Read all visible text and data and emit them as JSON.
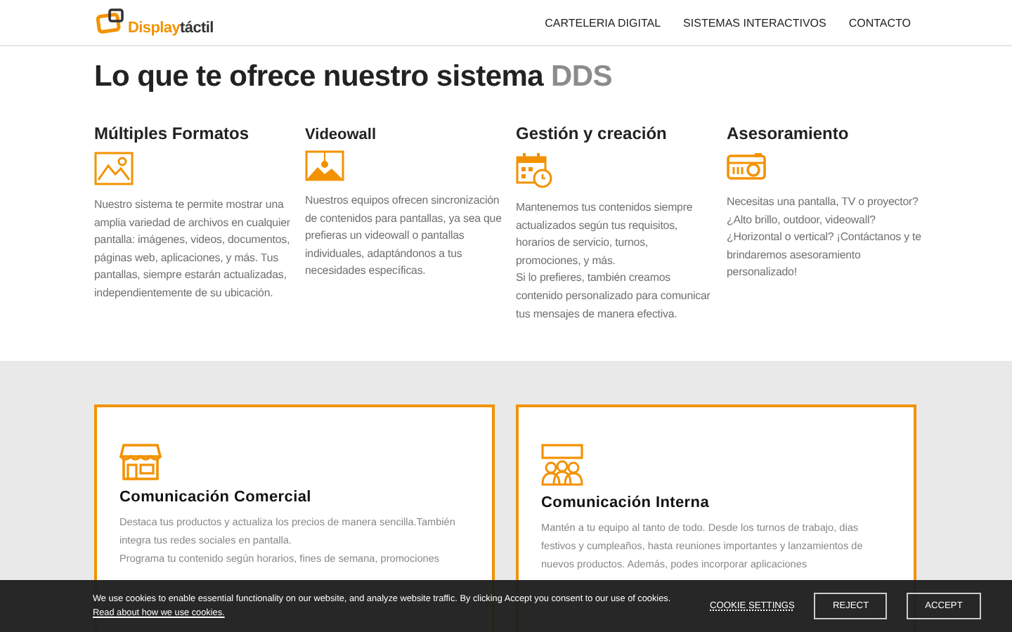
{
  "logo": {
    "brand_first": "Display",
    "brand_second": "táctil"
  },
  "nav": [
    {
      "label": "CARTELERIA DIGITAL"
    },
    {
      "label": "SISTEMAS INTERACTIVOS"
    },
    {
      "label": "CONTACTO"
    }
  ],
  "heading": {
    "text": "Lo que te ofrece nuestro sistema",
    "accent": "DDS"
  },
  "features": [
    {
      "kind": "image",
      "title": "Múltiples Formatos",
      "text": "Nuestro sistema te permite mostrar una amplia variedad de archivos en cualquier pantalla: imágenes, videos, documentos, páginas web, aplicaciones, y más. Tus pantallas, siempre estarán actualizadas, independientemente de su ubicación."
    },
    {
      "kind": "videowall",
      "title": "Videowall",
      "text": "Nuestros equipos ofrecen sincronización de contenidos para pantallas, ya sea que prefieras un videowall o pantallas individuales, adaptándonos a tus necesidades específicas."
    },
    {
      "kind": "calendar",
      "title": "Gestión y creación",
      "text": "Mantenemos tus contenidos siempre actualizados según tus requisitos, horarios de servicio, turnos, promociones, y más.\nSi lo prefieres, también creamos contenido personalizado para comunicar tus mensajes de manera efectiva."
    },
    {
      "kind": "projector",
      "title": "Asesoramiento",
      "text": "Necesitas una pantalla, TV o proyector? ¿Alto brillo, outdoor, videowall? ¿Horizontal o vertical? ¡Contáctanos y te brindaremos asesoramiento personalizado!"
    }
  ],
  "cards": [
    {
      "kind": "store",
      "title": "Comunicación Comercial",
      "text": "Destaca tus productos y actualiza los precios de manera sencilla.También integra tus redes sociales en pantalla.\nPrograma tu contenido según horarios, fines de semana, promociones"
    },
    {
      "kind": "team",
      "title": "Comunicación Interna",
      "text": "Mantén a tu equipo al tanto de todo. Desde los turnos de trabajo, dias festivos y cumpleaños, hasta reuniones importantes y lanzamientos de nuevos productos. Además, podes incorporar aplicaciones"
    }
  ],
  "cookie_bar": {
    "text": "We use cookies to enable essential functionality on our website, and analyze website traffic. By clicking Accept you consent to our use of cookies.",
    "link": "Read about how we use cookies.",
    "settings": "COOKIE SETTINGS",
    "buttons": [
      "REJECT",
      "ACCEPT"
    ]
  }
}
